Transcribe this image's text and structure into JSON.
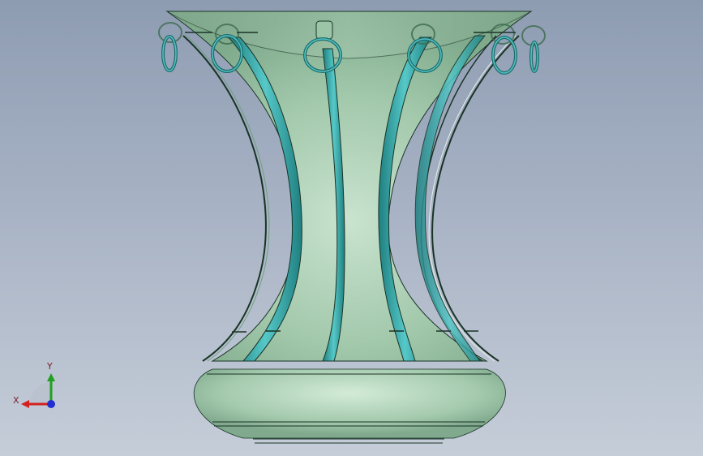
{
  "viewport": {
    "background_top": "#8e9cb2",
    "background_bottom": "#c5cdd8"
  },
  "model": {
    "body_color": "#a8ccb0",
    "edge_color": "#1a3326",
    "rib_color": "#3fb0b0",
    "ring_color": "#2a8c8c"
  },
  "triad": {
    "x_label": "X",
    "y_label": "Y",
    "x_color": "#d42020",
    "y_color": "#20a020",
    "z_color": "#2030d0"
  }
}
